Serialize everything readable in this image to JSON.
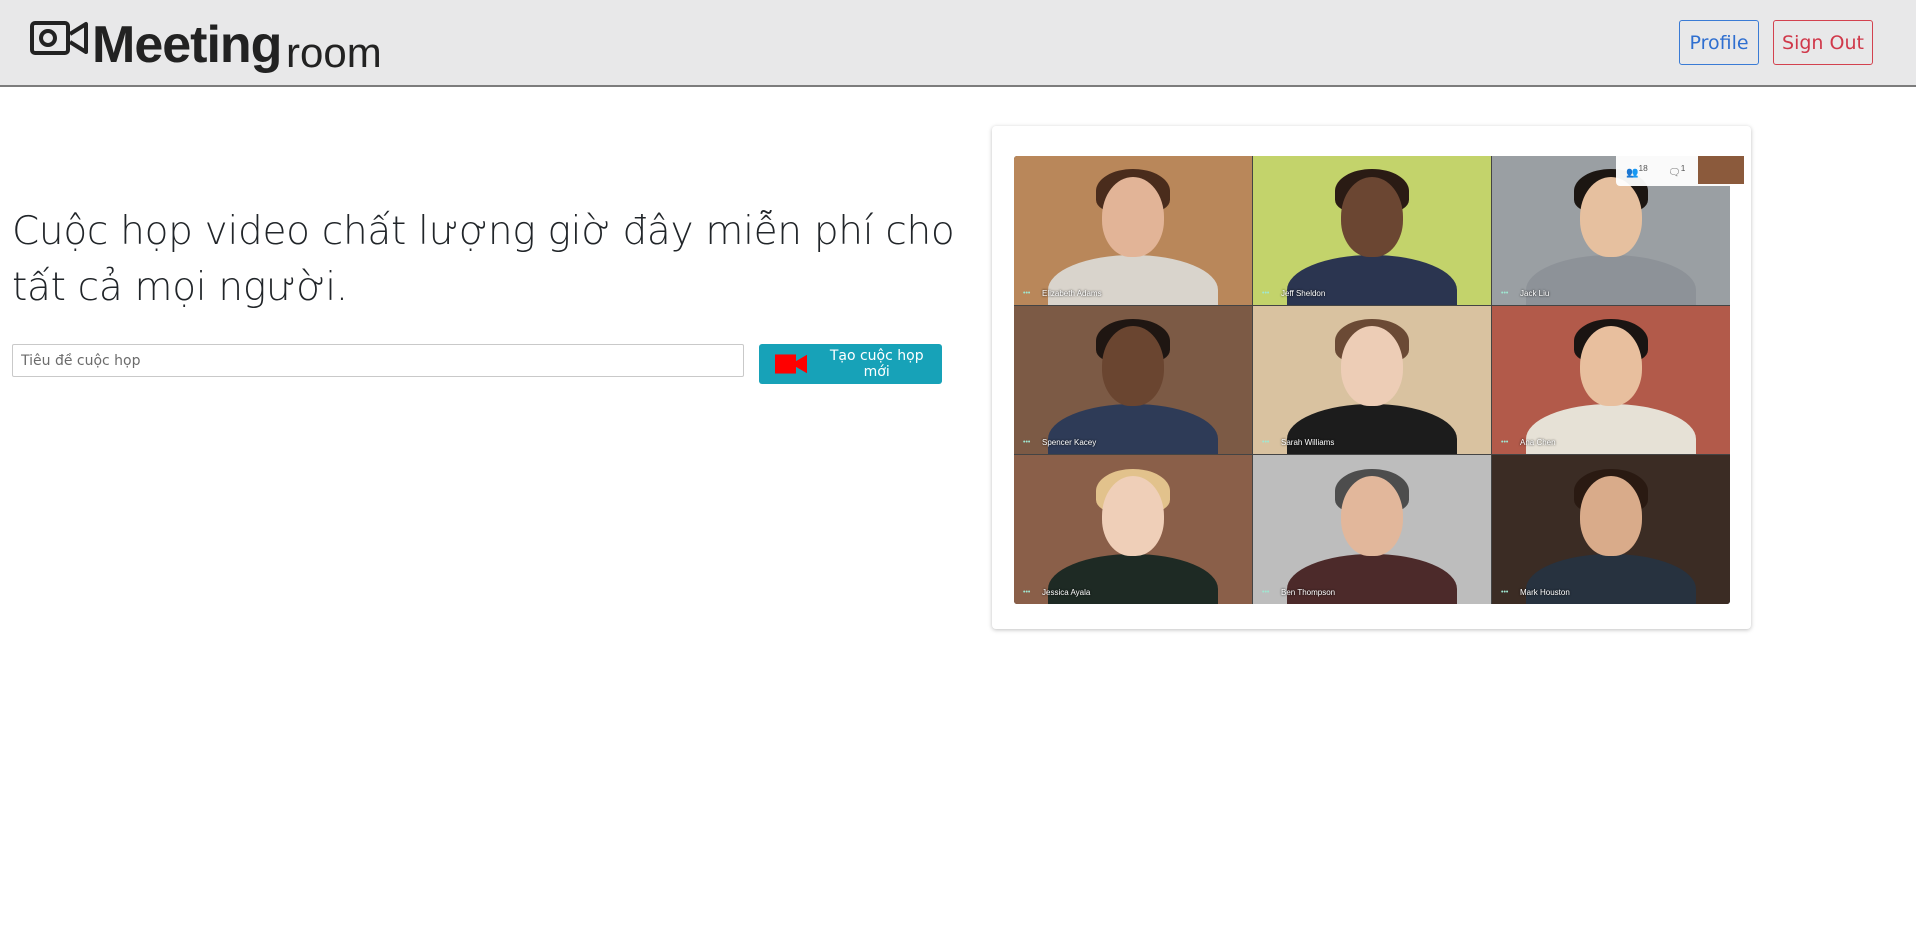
{
  "header": {
    "brand_strong": "Meeting",
    "brand_light": "room",
    "profile_label": "Profile",
    "signout_label": "Sign Out"
  },
  "hero": {
    "title": "Cuộc họp video chất lượng giờ đây miễn phí cho tất cả mọi người.",
    "input_placeholder": "Tiêu đề cuộc họp",
    "create_label": "Tạo cuộc họp mới"
  },
  "preview": {
    "participants_count": "18",
    "chat_count": "1",
    "tiles": [
      {
        "name": "Elizabeth Adams",
        "bg": "#b9875a",
        "skin": "#e2b497",
        "hair": "#4a2c1c",
        "shirt": "#d9d4cc"
      },
      {
        "name": "Jeff Sheldon",
        "bg": "#c3d36b",
        "skin": "#6b4632",
        "hair": "#2a1b14",
        "shirt": "#2b3550"
      },
      {
        "name": "Jack Liu",
        "bg": "#9a9fa3",
        "skin": "#e6c09f",
        "hair": "#1c1612",
        "shirt": "#8d9298"
      },
      {
        "name": "Spencer Kacey",
        "bg": "#7c5a45",
        "skin": "#6a4530",
        "hair": "#1f1612",
        "shirt": "#2e3b57"
      },
      {
        "name": "Sarah Williams",
        "bg": "#d9c2a0",
        "skin": "#edcdb6",
        "hair": "#6b4a35",
        "shirt": "#1c1c1c"
      },
      {
        "name": "Ana Chen",
        "bg": "#b25a4a",
        "skin": "#e8bf9e",
        "hair": "#1a1412",
        "shirt": "#e6e1d6"
      },
      {
        "name": "Jessica Ayala",
        "bg": "#8a5f49",
        "skin": "#efcfb8",
        "hair": "#e2c28c",
        "shirt": "#1e2a24"
      },
      {
        "name": "Ben Thompson",
        "bg": "#bdbdbd",
        "skin": "#e2b79b",
        "hair": "#4d4d4d",
        "shirt": "#4c2a2a"
      },
      {
        "name": "Mark Houston",
        "bg": "#3b2c24",
        "skin": "#d9ab8a",
        "hair": "#2a1a12",
        "shirt": "#27323f"
      }
    ]
  }
}
